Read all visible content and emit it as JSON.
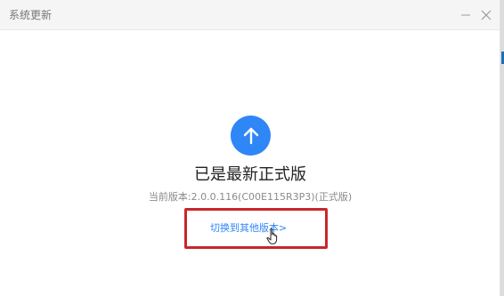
{
  "window": {
    "title": "系统更新"
  },
  "controls": {
    "minimize_icon": "minimize-icon",
    "close_icon": "close-icon"
  },
  "status": {
    "icon": "arrow-up-icon",
    "title": "已是最新正式版",
    "version_text": "当前版本:2.0.0.116(C00E115R3P3)(正式版)"
  },
  "actions": {
    "switch_version_label": "切换到其他版本>"
  },
  "colors": {
    "accent": "#2f86f6",
    "highlight": "#c9262b",
    "title_bar": "#f5f5f5"
  }
}
